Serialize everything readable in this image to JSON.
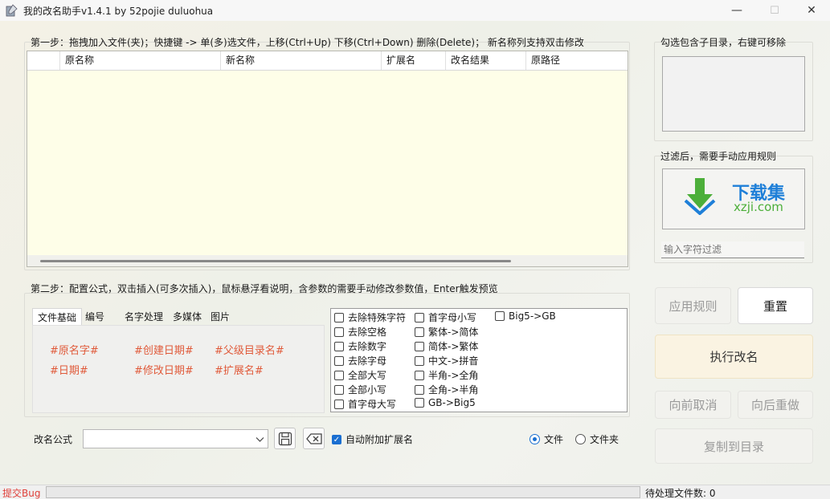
{
  "window": {
    "title": "我的改名助手v1.4.1 by 52pojie duluohua",
    "min_glyph": "—",
    "max_glyph": "☐",
    "close_glyph": "✕"
  },
  "step1": {
    "legend": "第一步：拖拽加入文件(夹)；快捷键 -> 单(多)选文件，上移(Ctrl+Up) 下移(Ctrl+Down) 删除(Delete)；  新名称列支持双击修改",
    "columns": [
      "原名称",
      "新名称",
      "扩展名",
      "改名结果",
      "原路径"
    ]
  },
  "step2": {
    "legend": "第二步：配置公式，双击插入(可多次插入)，鼠标悬浮看说明，含参数的需要手动修改参数值，Enter触发预览",
    "tabs": [
      "文件基础",
      "编号",
      "名字处理",
      "多媒体",
      "图片"
    ],
    "active_tab": 0,
    "tokens": [
      "#原名字#",
      "#创建日期#",
      "#父级目录名#",
      "#日期#",
      "#修改日期#",
      "#扩展名#"
    ],
    "options": [
      [
        "去除特殊字符",
        "去除空格",
        "去除数字",
        "去除字母",
        "全部大写",
        "全部小写",
        "首字母大写"
      ],
      [
        "首字母小写",
        "繁体->简体",
        "简体->繁体",
        "中文->拼音",
        "半角->全角",
        "全角->半角",
        "GB->Big5"
      ],
      [
        "Big5->GB"
      ]
    ]
  },
  "formula": {
    "label": "改名公式",
    "value": "",
    "auto_ext_label": "自动附加扩展名",
    "auto_ext_checked": true,
    "mode_file_label": "文件",
    "mode_folder_label": "文件夹",
    "mode_selected": "file"
  },
  "right": {
    "subdir_legend": "勾选包含子目录，右键可移除",
    "filter_legend": "过滤后，需要手动应用规则",
    "watermark_text": "下载集",
    "watermark_url": "xzji.com",
    "filter_placeholder": "输入字符过滤",
    "apply_label": "应用规则",
    "reset_label": "重置",
    "execute_label": "执行改名",
    "undo_label": "向前取消",
    "redo_label": "向后重做",
    "copy_label": "复制到目录"
  },
  "status": {
    "bug_link": "提交Bug",
    "pending_label": "待处理文件数: 0"
  },
  "colors": {
    "accent": "#1a6fd1",
    "token": "#e05a3a",
    "table_bg": "#fefee8",
    "bug_link": "#e0403a",
    "watermark_green": "#4caf3a",
    "watermark_blue": "#1e7fd8"
  }
}
